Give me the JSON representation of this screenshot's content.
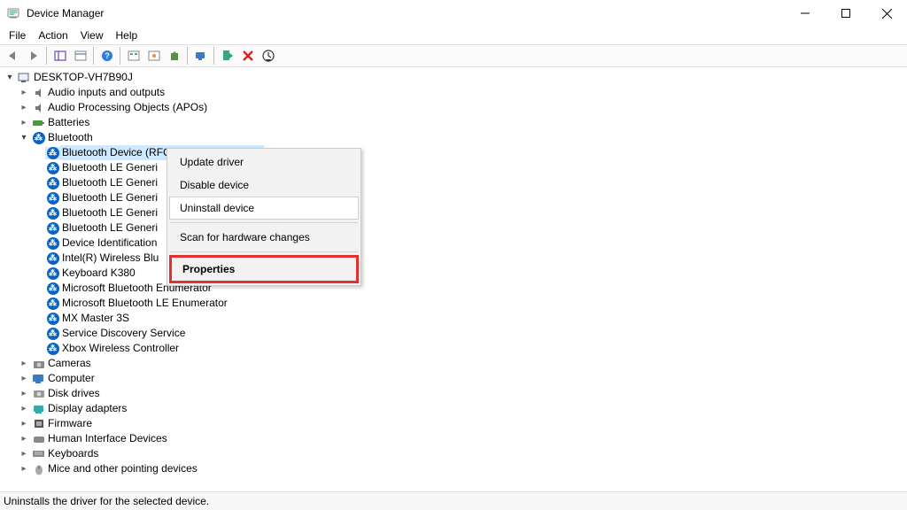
{
  "window": {
    "title": "Device Manager"
  },
  "menubar": {
    "file": "File",
    "action": "Action",
    "view": "View",
    "help": "Help"
  },
  "tree": {
    "root": "DESKTOP-VH7B90J",
    "bluetooth": {
      "label": "Bluetooth",
      "children": [
        "Bluetooth Device (RFCOMM Protocol TDI)",
        "Bluetooth LE Generi",
        "Bluetooth LE Generi",
        "Bluetooth LE Generi",
        "Bluetooth LE Generi",
        "Bluetooth LE Generi",
        "Device Identification",
        "Intel(R) Wireless Blu",
        "Keyboard K380",
        "Microsoft Bluetooth Enumerator",
        "Microsoft Bluetooth LE Enumerator",
        "MX Master 3S",
        "Service Discovery Service",
        "Xbox Wireless Controller"
      ]
    },
    "others": {
      "audio_io": "Audio inputs and outputs",
      "apo": "Audio Processing Objects (APOs)",
      "batteries": "Batteries",
      "cameras": "Cameras",
      "computer": "Computer",
      "disk": "Disk drives",
      "display": "Display adapters",
      "firmware": "Firmware",
      "hid": "Human Interface Devices",
      "keyboards": "Keyboards",
      "mice": "Mice and other pointing devices"
    }
  },
  "context_menu": {
    "update": "Update driver",
    "disable": "Disable device",
    "uninstall": "Uninstall device",
    "scan": "Scan for hardware changes",
    "properties": "Properties"
  },
  "statusbar": {
    "text": "Uninstalls the driver for the selected device."
  }
}
